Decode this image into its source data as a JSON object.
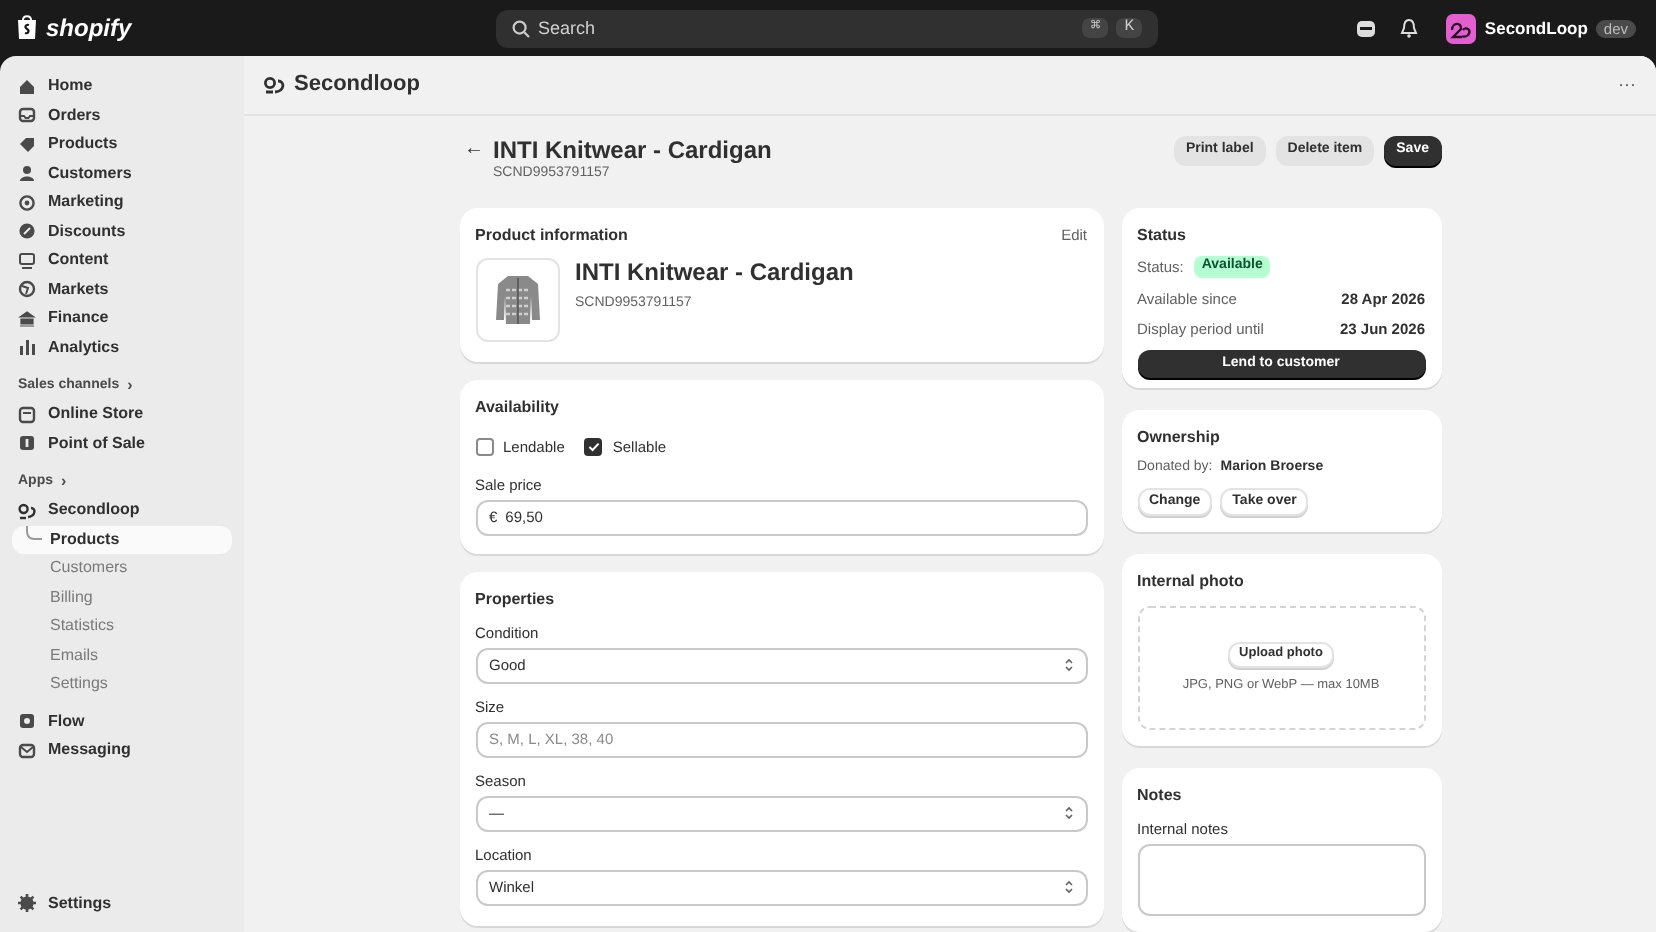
{
  "topbar": {
    "logo_text": "shopify",
    "search": {
      "placeholder": "Search",
      "keys": [
        "⌘",
        "K"
      ]
    },
    "store": {
      "name": "SecondLoop",
      "badge": "dev"
    }
  },
  "sidebar": {
    "items": [
      {
        "label": "Home",
        "selected": false
      },
      {
        "label": "Orders",
        "selected": false
      },
      {
        "label": "Products",
        "selected": false
      },
      {
        "label": "Customers",
        "selected": false
      },
      {
        "label": "Marketing",
        "selected": false
      },
      {
        "label": "Discounts",
        "selected": false
      },
      {
        "label": "Content",
        "selected": false
      },
      {
        "label": "Markets",
        "selected": false
      },
      {
        "label": "Finance",
        "selected": false
      },
      {
        "label": "Analytics",
        "selected": false
      }
    ],
    "sales_channels": {
      "heading": "Sales channels",
      "caret": "›",
      "items": [
        {
          "label": "Online Store",
          "selected": false
        },
        {
          "label": "Point of Sale",
          "selected": false
        }
      ]
    },
    "apps": {
      "heading": "Apps",
      "caret": "›",
      "app": {
        "label": "Secondloop",
        "children": [
          {
            "label": "Products",
            "selected": true
          },
          {
            "label": "Customers",
            "selected": false
          },
          {
            "label": "Billing",
            "selected": false
          },
          {
            "label": "Statistics",
            "selected": false
          },
          {
            "label": "Emails",
            "selected": false
          },
          {
            "label": "Settings",
            "selected": false
          }
        ]
      },
      "items": [
        {
          "label": "Flow",
          "selected": false
        },
        {
          "label": "Messaging",
          "selected": false
        }
      ]
    },
    "footer": {
      "label": "Settings"
    }
  },
  "app_header": {
    "title": "Secondloop",
    "menu": "···"
  },
  "page": {
    "back": "←",
    "title": "INTI Knitwear - Cardigan",
    "subtitle": "SCND9953791157",
    "actions": [
      {
        "label": "Print label",
        "kind": "secondary"
      },
      {
        "label": "Delete item",
        "kind": "secondary"
      },
      {
        "label": "Save",
        "kind": "primary"
      }
    ]
  },
  "product_card": {
    "heading": "Product information",
    "edit": "Edit",
    "name": "INTI Knitwear - Cardigan",
    "sku": "SCND9953791157"
  },
  "availability_card": {
    "heading": "Availability",
    "checkboxes": [
      {
        "label": "Lendable",
        "checked": false
      },
      {
        "label": "Sellable",
        "checked": true
      }
    ],
    "price": {
      "label": "Sale price",
      "prefix": "€",
      "value": "69,50"
    }
  },
  "properties_card": {
    "heading": "Properties",
    "fields": [
      {
        "label": "Condition",
        "kind": "select",
        "value": "Good"
      },
      {
        "label": "Size",
        "kind": "text",
        "placeholder": "S, M, L, XL, 38, 40"
      },
      {
        "label": "Season",
        "kind": "select",
        "value": "—"
      },
      {
        "label": "Location",
        "kind": "select",
        "value": "Winkel"
      }
    ]
  },
  "status_card": {
    "heading": "Status",
    "status_label": "Status:",
    "badge": "Available",
    "rows": [
      {
        "label": "Available since",
        "value": "28 Apr 2026"
      },
      {
        "label": "Display period until",
        "value": "23 Jun 2026"
      }
    ],
    "button": "Lend to customer"
  },
  "ownership_card": {
    "heading": "Ownership",
    "label": "Donated by:",
    "value": "Marion Broerse",
    "buttons": [
      "Change",
      "Take over"
    ]
  },
  "photo_card": {
    "heading": "Internal photo",
    "button": "Upload photo",
    "hint": "JPG, PNG or WebP — max 10MB"
  },
  "notes_card": {
    "heading": "Notes",
    "label": "Internal notes"
  }
}
